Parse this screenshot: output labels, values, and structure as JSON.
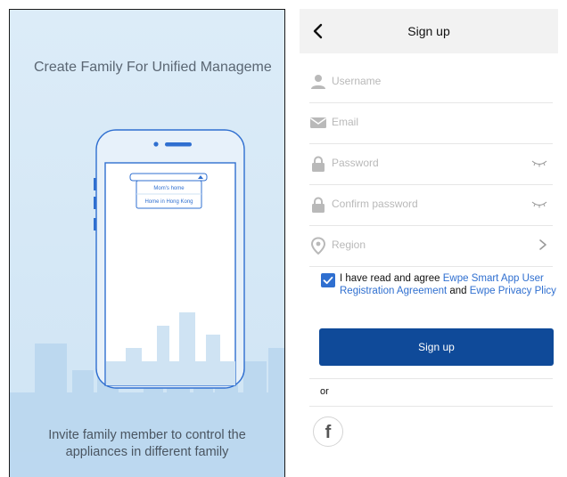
{
  "onboarding": {
    "title": "Create Family For Unified Manageme",
    "dropdown_items": [
      "Mom's home",
      "Home in Hong Kong"
    ],
    "footer_line1": "Invite family member to control the",
    "footer_line2": "appliances in different family"
  },
  "signup": {
    "header_title": "Sign up",
    "fields": {
      "username": {
        "placeholder": "Username",
        "icon": "person-icon"
      },
      "email": {
        "placeholder": "Email",
        "icon": "mail-icon"
      },
      "password": {
        "placeholder": "Password",
        "icon": "lock-icon"
      },
      "confirm_password": {
        "placeholder": "Confirm password",
        "icon": "lock-icon"
      },
      "region": {
        "placeholder": "Region",
        "icon": "location-pin-icon"
      }
    },
    "agreement": {
      "checked": true,
      "prefix": "I have read and agree ",
      "link1": "Ewpe Smart App User Registration Agreement",
      "middle": " and ",
      "link2": "Ewpe Privacy Plicy"
    },
    "submit_label": "Sign up",
    "or_label": "or",
    "social": {
      "facebook_glyph": "f"
    }
  },
  "colors": {
    "accent": "#0f4a99",
    "link": "#2f6fd0",
    "illustration_blue": "#2f6fd0",
    "placeholder": "#b9b9b9"
  }
}
